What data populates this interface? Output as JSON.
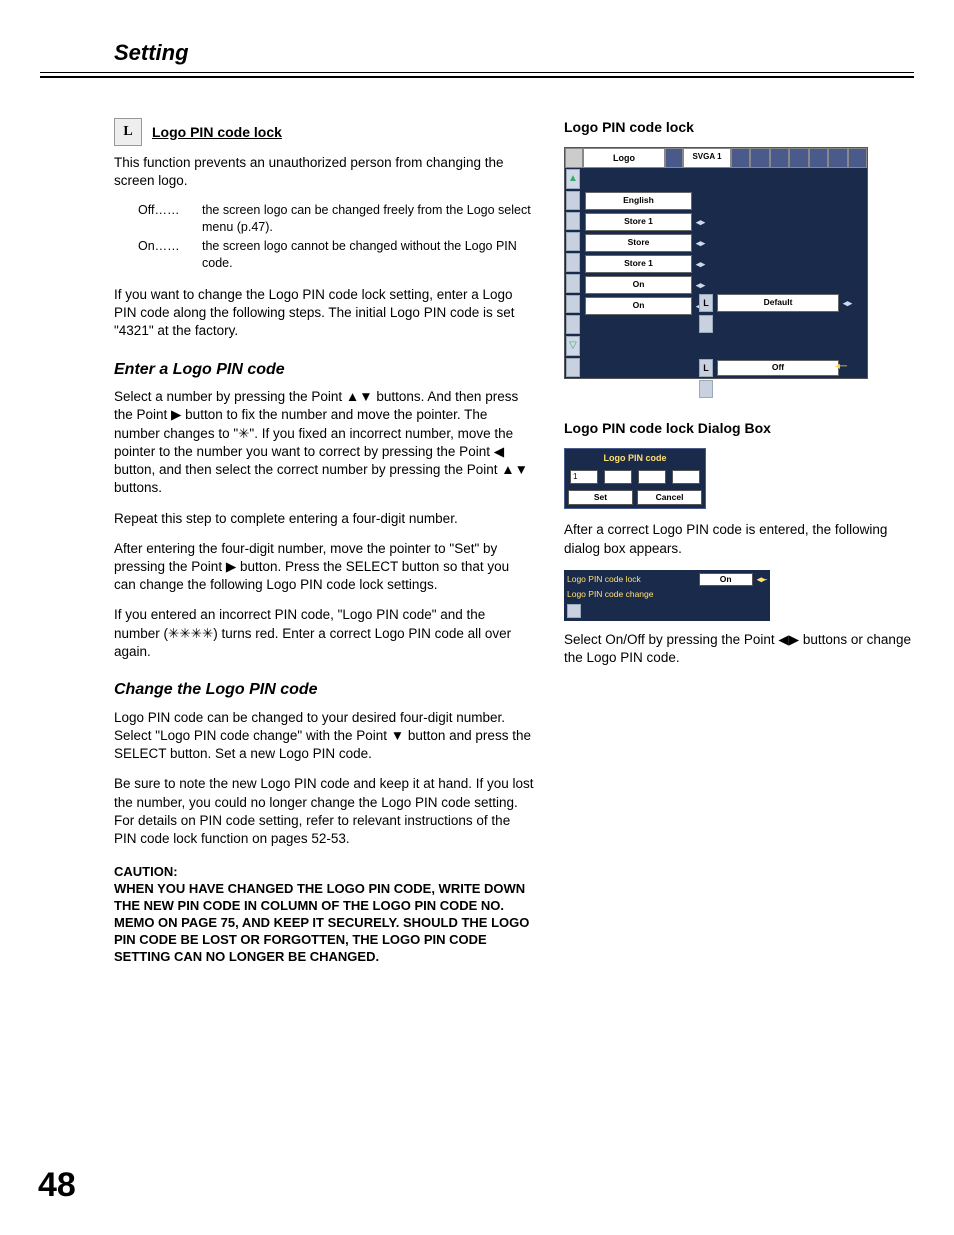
{
  "header": {
    "section": "Setting"
  },
  "left": {
    "icon_label": "L",
    "h1": "Logo PIN code lock",
    "p1": "This function prevents an unauthorized person from changing the screen logo.",
    "opts": {
      "off_label": "Off……",
      "off_text": "the screen logo can be changed freely from the Logo select menu (p.47).",
      "on_label": "On……",
      "on_text": "the screen logo cannot be changed without the Logo PIN code."
    },
    "p2": "If you want to change the Logo PIN code lock setting, enter a Logo PIN code along the following steps. The initial Logo PIN code is set \"4321\" at the factory.",
    "h2": "Enter a Logo PIN code",
    "p3": "Select a number by pressing the Point ▲▼ buttons. And then press the Point ▶ button to fix the number and move the pointer.  The number changes to \"✳\".  If you fixed an incorrect number, move the pointer to the number you want to correct by pressing the Point ◀ button, and then select the correct number by pressing the Point ▲▼ buttons.",
    "p4": "Repeat this step to complete entering a four-digit number.",
    "p5": "After entering the four-digit number, move the pointer to \"Set\" by pressing the Point ▶ button. Press the SELECT button so that you can change the following Logo PIN code lock settings.",
    "p6": "If you entered an incorrect PIN code, \"Logo PIN code\" and the number (✳✳✳✳) turns red. Enter a correct Logo PIN code all over again.",
    "h3": "Change the Logo PIN code",
    "p7": "Logo PIN code can be changed to your desired four-digit number. Select \"Logo PIN code change\" with the Point ▼ button and press the SELECT button. Set a new Logo PIN code.",
    "p8": "Be sure to note the new Logo PIN code and keep it at hand. If you lost the number, you could no longer change the Logo PIN code setting. For details on PIN code setting, refer to relevant instructions of the PIN code lock function on pages 52-53.",
    "caution_h": "CAUTION:",
    "caution_b": "WHEN YOU HAVE CHANGED THE LOGO PIN CODE, WRITE DOWN THE NEW PIN CODE IN COLUMN OF THE LOGO PIN CODE NO. MEMO ON PAGE 75, AND KEEP IT SECURELY. SHOULD THE LOGO PIN CODE BE LOST OR FORGOTTEN, THE LOGO PIN CODE SETTING CAN NO LONGER BE CHANGED."
  },
  "right": {
    "h1": "Logo PIN code lock",
    "osd": {
      "top_label": "Logo",
      "svga": "SVGA 1",
      "vals": [
        "English",
        "Store 1",
        "Store",
        "Store 1",
        "On",
        "On"
      ],
      "sub_default": "Default",
      "sub_off": "Off"
    },
    "h2": "Logo PIN code lock Dialog Box",
    "pin": {
      "title": "Logo PIN code",
      "digit1": "1",
      "set": "Set",
      "cancel": "Cancel"
    },
    "p_after": "After a correct Logo PIN code is entered, the following dialog box appears.",
    "lockchange": {
      "row1": "Logo PIN code lock",
      "row1_val": "On",
      "row2": "Logo PIN code change"
    },
    "p_select": "Select On/Off by pressing the Point ◀▶ buttons or change the Logo PIN code."
  },
  "page_number": "48"
}
